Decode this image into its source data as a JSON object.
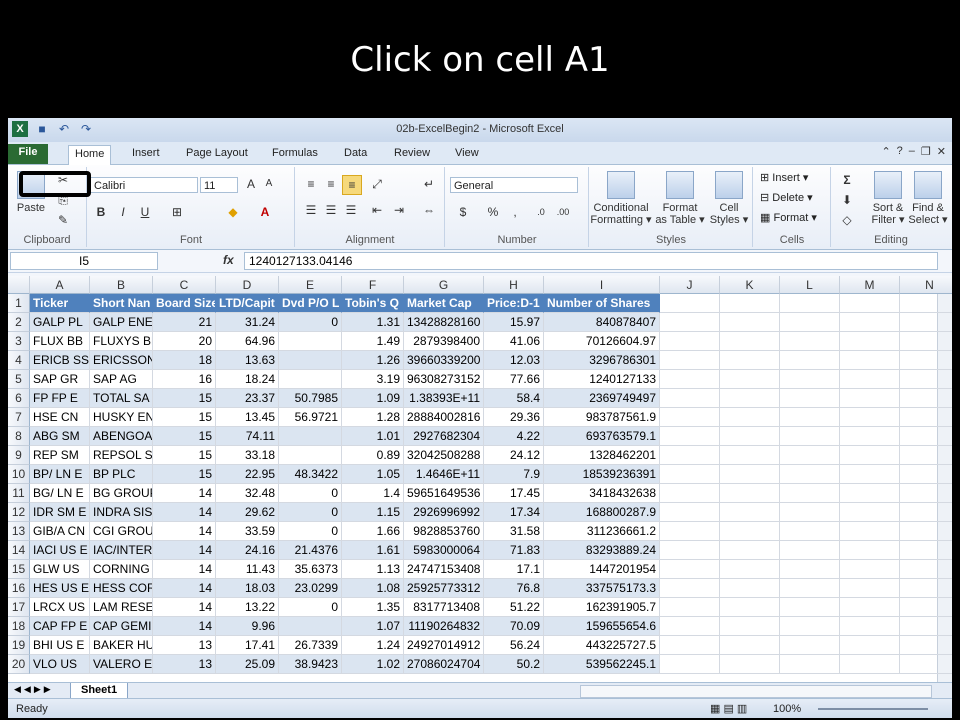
{
  "caption": "Click on cell A1",
  "window": {
    "title": "02b-ExcelBegin2  -  Microsoft Excel",
    "tabs": [
      "File",
      "Home",
      "Insert",
      "Page Layout",
      "Formulas",
      "Data",
      "Review",
      "View"
    ],
    "active_tab": "Home"
  },
  "ribbon": {
    "clipboard": {
      "paste": "Paste",
      "label": "Clipboard"
    },
    "font": {
      "name": "Calibri",
      "size": "11",
      "bold": "B",
      "italic": "I",
      "underline": "U",
      "label": "Font"
    },
    "alignment": {
      "label": "Alignment"
    },
    "number": {
      "format": "General",
      "percent": "%",
      "comma": ",",
      "label": "Number"
    },
    "styles": {
      "conditional": [
        "Conditional",
        "Formatting ▾"
      ],
      "format_table": [
        "Format",
        "as Table ▾"
      ],
      "cell_styles": [
        "Cell",
        "Styles ▾"
      ],
      "label": "Styles"
    },
    "cells": {
      "insert": "Insert ▾",
      "delete": "Delete ▾",
      "format": "Format ▾",
      "label": "Cells"
    },
    "editing": {
      "sort": [
        "Sort &",
        "Filter ▾"
      ],
      "find": [
        "Find &",
        "Select ▾"
      ],
      "label": "Editing"
    }
  },
  "formula_bar": {
    "name_box": "I5",
    "fx": "fx",
    "value": "1240127133.04146"
  },
  "columns": [
    "A",
    "B",
    "C",
    "D",
    "E",
    "F",
    "G",
    "H",
    "I",
    "J",
    "K",
    "L",
    "M",
    "N"
  ],
  "rows": [
    [
      "Ticker",
      "Short Nan",
      "Board Size",
      "LTD/Capit",
      "Dvd P/O L",
      "Tobin's Q",
      "Market Cap",
      "Price:D-1",
      "Number of Shares"
    ],
    [
      "GALP   PL",
      "GALP ENEI",
      "21",
      "31.24",
      "0",
      "1.31",
      "13428828160",
      "15.97",
      "840878407"
    ],
    [
      "FLUX   BB",
      "FLUXYS BE",
      "20",
      "64.96",
      "",
      "1.49",
      "2879398400",
      "41.06",
      "70126604.97"
    ],
    [
      "ERICB  SS",
      "ERICSSON",
      "18",
      "13.63",
      "",
      "1.26",
      "39660339200",
      "12.03",
      "3296786301"
    ],
    [
      "SAP    GR",
      "SAP AG",
      "16",
      "18.24",
      "",
      "3.19",
      "96308273152",
      "77.66",
      "1240127133"
    ],
    [
      "FP     FP E",
      "TOTAL SA",
      "15",
      "23.37",
      "50.7985",
      "1.09",
      "1.38393E+11",
      "58.4",
      "2369749497"
    ],
    [
      "HSE    CN",
      "HUSKY EN",
      "15",
      "13.45",
      "56.9721",
      "1.28",
      "28884002816",
      "29.36",
      "983787561.9"
    ],
    [
      "ABG    SM",
      "ABENGOA",
      "15",
      "74.11",
      "",
      "1.01",
      "2927682304",
      "4.22",
      "693763579.1"
    ],
    [
      "REP    SM",
      "REPSOL SA",
      "15",
      "33.18",
      "",
      "0.89",
      "32042508288",
      "24.12",
      "1328462201"
    ],
    [
      "BP/    LN E",
      "BP PLC",
      "15",
      "22.95",
      "48.3422",
      "1.05",
      "1.4646E+11",
      "7.9",
      "18539236391"
    ],
    [
      "BG/    LN E",
      "BG GROUP",
      "14",
      "32.48",
      "0",
      "1.4",
      "59651649536",
      "17.45",
      "3418432638"
    ],
    [
      "IDR    SM E",
      "INDRA SIS",
      "14",
      "29.62",
      "0",
      "1.15",
      "2926996992",
      "17.34",
      "168800287.9"
    ],
    [
      "GIB/A  CN",
      "CGI GROU",
      "14",
      "33.59",
      "0",
      "1.66",
      "9828853760",
      "31.58",
      "311236661.2"
    ],
    [
      "IACI   US E",
      "IAC/INTER",
      "14",
      "24.16",
      "21.4376",
      "1.61",
      "5983000064",
      "71.83",
      "83293889.24"
    ],
    [
      "GLW    US",
      "CORNING",
      "14",
      "11.43",
      "35.6373",
      "1.13",
      "24747153408",
      "17.1",
      "1447201954"
    ],
    [
      "HES    US E",
      "HESS CORI",
      "14",
      "18.03",
      "23.0299",
      "1.08",
      "25925773312",
      "76.8",
      "337575173.3"
    ],
    [
      "LRCX   US",
      "LAM RESE",
      "14",
      "13.22",
      "0",
      "1.35",
      "8317713408",
      "51.22",
      "162391905.7"
    ],
    [
      "CAP    FP E",
      "CAP GEMI",
      "14",
      "9.96",
      "",
      "1.07",
      "11190264832",
      "70.09",
      "159655654.6"
    ],
    [
      "BHI    US E",
      "BAKER HU",
      "13",
      "17.41",
      "26.7339",
      "1.24",
      "24927014912",
      "56.24",
      "443225727.5"
    ],
    [
      "VLO    US",
      "VALERO E",
      "13",
      "25.09",
      "38.9423",
      "1.02",
      "27086024704",
      "50.2",
      "539562245.1"
    ]
  ],
  "sheet_tab": "Sheet1",
  "status": {
    "ready": "Ready",
    "zoom": "100%"
  }
}
